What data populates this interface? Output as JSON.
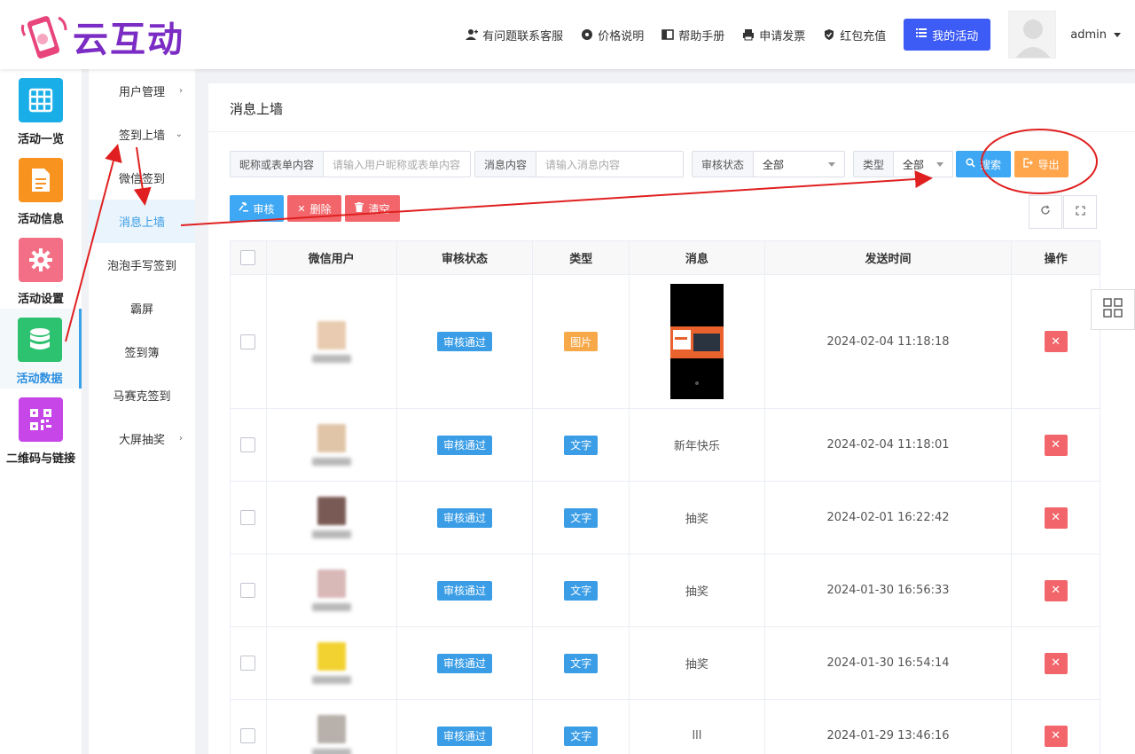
{
  "header": {
    "logo_text": "云互动",
    "links": [
      {
        "label": "有问题联系客服",
        "icon": "user-add-icon"
      },
      {
        "label": "价格说明",
        "icon": "gear-badge-icon"
      },
      {
        "label": "帮助手册",
        "icon": "book-icon"
      },
      {
        "label": "申请发票",
        "icon": "printer-icon"
      },
      {
        "label": "红包充值",
        "icon": "shield-check-icon"
      }
    ],
    "my_activity": "我的活动",
    "username": "admin"
  },
  "icon_sidebar": [
    {
      "label": "活动一览",
      "icon": "grid-icon",
      "color": "#1aaee8"
    },
    {
      "label": "活动信息",
      "icon": "document-icon",
      "color": "#f7931e"
    },
    {
      "label": "活动设置",
      "icon": "gear-icon",
      "color": "#f26f86"
    },
    {
      "label": "活动数据",
      "icon": "database-icon",
      "color": "#2cc26f",
      "active": true
    },
    {
      "label": "二维码与链接",
      "icon": "qrcode-icon",
      "color": "#c646e8"
    }
  ],
  "sub_sidebar": {
    "items": [
      {
        "label": "用户管理",
        "chev": "›"
      },
      {
        "label": "签到上墙",
        "chev": "⌄"
      },
      {
        "label": "微信签到"
      },
      {
        "label": "消息上墙",
        "active": true
      },
      {
        "label": "泡泡手写签到"
      },
      {
        "label": "霸屏"
      },
      {
        "label": "签到簿"
      },
      {
        "label": "马赛克签到"
      },
      {
        "label": "大屏抽奖",
        "chev": "›"
      }
    ]
  },
  "panel": {
    "title": "消息上墙",
    "filters": {
      "nickname_label": "昵称或表单内容",
      "nickname_placeholder": "请输入用户昵称或表单内容",
      "content_label": "消息内容",
      "content_placeholder": "请输入消息内容",
      "status_label": "审核状态",
      "status_value": "全部",
      "type_label": "类型",
      "type_value": "全部",
      "search": "搜索",
      "export": "导出"
    },
    "actions": {
      "approve": "审核",
      "delete": "删除",
      "clear": "清空"
    },
    "columns": [
      "微信用户",
      "审核状态",
      "类型",
      "消息",
      "发送时间",
      "操作"
    ],
    "rows": [
      {
        "status": "审核通过",
        "type": "图片",
        "type_color": "#f7a94a",
        "message": "",
        "time": "2024-02-04 11:18:18",
        "avatar_color": "#e8cbb0"
      },
      {
        "status": "审核通过",
        "type": "文字",
        "type_color": "#3a9de6",
        "message": "新年快乐",
        "time": "2024-02-04 11:18:01",
        "avatar_color": "#e0c5a8"
      },
      {
        "status": "审核通过",
        "type": "文字",
        "type_color": "#3a9de6",
        "message": "抽奖",
        "time": "2024-02-01 16:22:42",
        "avatar_color": "#7a5a55"
      },
      {
        "status": "审核通过",
        "type": "文字",
        "type_color": "#3a9de6",
        "message": "抽奖",
        "time": "2024-01-30 16:56:33",
        "avatar_color": "#d9b8b8"
      },
      {
        "status": "审核通过",
        "type": "文字",
        "type_color": "#3a9de6",
        "message": "抽奖",
        "time": "2024-01-30 16:54:14",
        "avatar_color": "#f2d230"
      },
      {
        "status": "审核通过",
        "type": "文字",
        "type_color": "#3a9de6",
        "message": "lll",
        "time": "2024-01-29 13:46:16",
        "avatar_color": "#b8b0aa"
      }
    ]
  },
  "colors": {
    "accent": "#3d5bf5",
    "annotation": "#e02020"
  }
}
